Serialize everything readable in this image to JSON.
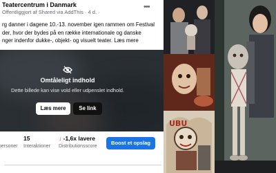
{
  "post": {
    "page_name": "Teatercentrum i Danmark",
    "meta": "Offentliggjort af Shared via AddThis · 4 d. · ",
    "more_icon": "ellipsis-icon",
    "text": "rg danner i dagene 10.-13. november igen rammen om Festival\nder, hvor der bydes på en række internationale og danske\nnger indenfor dukke-, objekt- og visuelt teater. Læs mere",
    "warning": {
      "icon": "eye-slash-icon",
      "title": "Omtåleligt indhold",
      "description": "Dette billede kan vise vold eller udpenslet indhold.",
      "learn_more_label": "Læs mere",
      "see_link_label": "Se link"
    },
    "stats": {
      "people_label": "personer",
      "interactions_value": "15",
      "interactions_label": "Interaktioner",
      "distribution_value": "-1,6x lavere",
      "distribution_label": "Distributionsscore",
      "arrow_icon": "arrow-down-icon"
    },
    "boost_label": "Boost et opslag"
  },
  "collage": {
    "photos": [
      "performers-photo",
      "puppet-head-photo",
      "woman-with-puppet-photo",
      "red-stage-photo",
      "illustrated-poster-photo",
      "mask-puppet-photo"
    ]
  },
  "colors": {
    "accent": "#1b74e4",
    "down_arrow": "#e41e3f",
    "overlay": "#2a2f34"
  }
}
